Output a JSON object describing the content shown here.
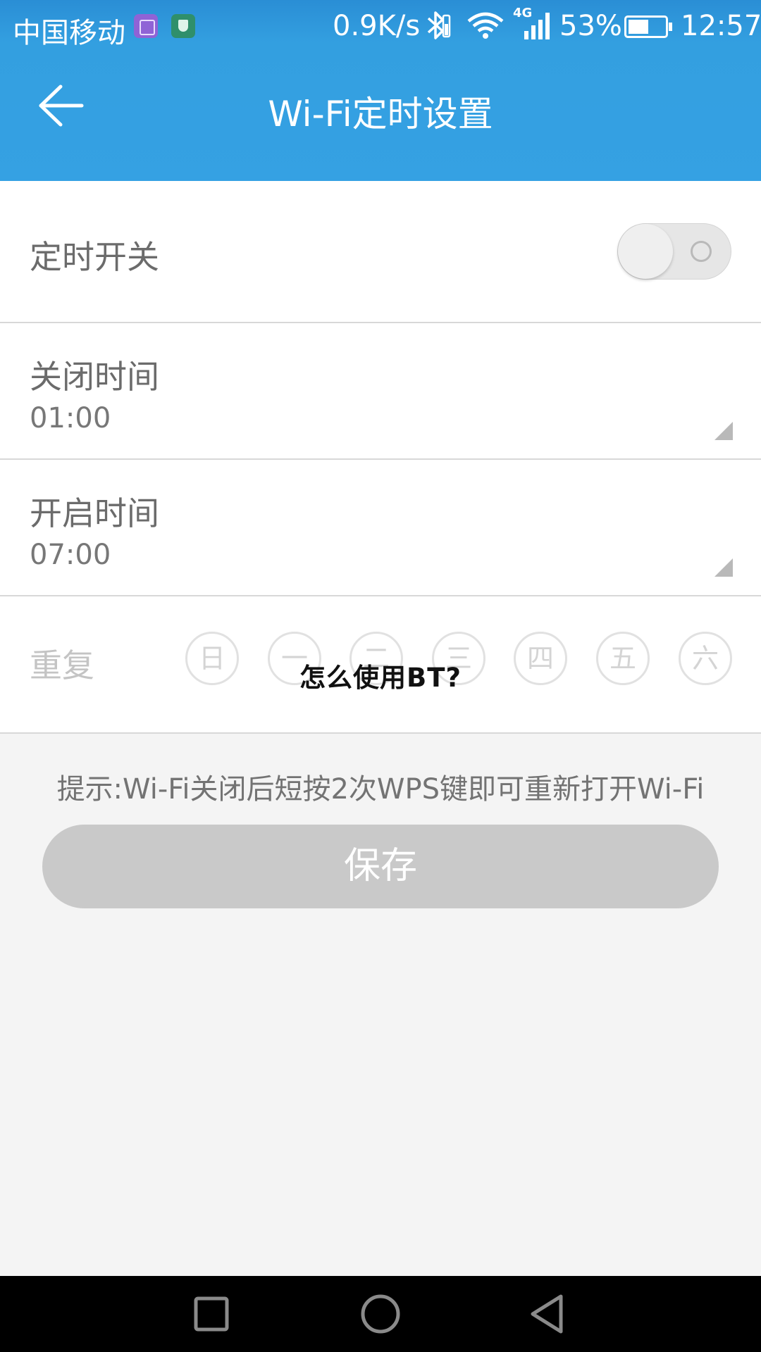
{
  "status_bar": {
    "carrier": "中国移动",
    "app_icons": [
      "gallery-icon",
      "shield-icon"
    ],
    "net_speed": "0.9K/s",
    "network_type": "4G",
    "battery": "53%",
    "time": "12:57"
  },
  "header": {
    "title": "Wi-Fi定时设置",
    "back_icon": "arrow-left-icon"
  },
  "settings": {
    "switch_label": "定时开关",
    "switch_on": false,
    "off_time": {
      "label": "关闭时间",
      "value": "01:00"
    },
    "on_time": {
      "label": "开启时间",
      "value": "07:00"
    },
    "repeat": {
      "label": "重复",
      "days": [
        "日",
        "一",
        "二",
        "三",
        "四",
        "五",
        "六"
      ]
    }
  },
  "overlay_text": "怎么使用BT?",
  "hint": "提示:Wi-Fi关闭后短按2次WPS键即可重新打开Wi-Fi",
  "save_label": "保存",
  "nav_bar": {
    "buttons": [
      "recent-apps-icon",
      "home-icon",
      "back-icon"
    ]
  },
  "colors": {
    "accent": "#35a1e3",
    "disabled_button": "#c9c9c9",
    "background": "#f4f4f4"
  }
}
